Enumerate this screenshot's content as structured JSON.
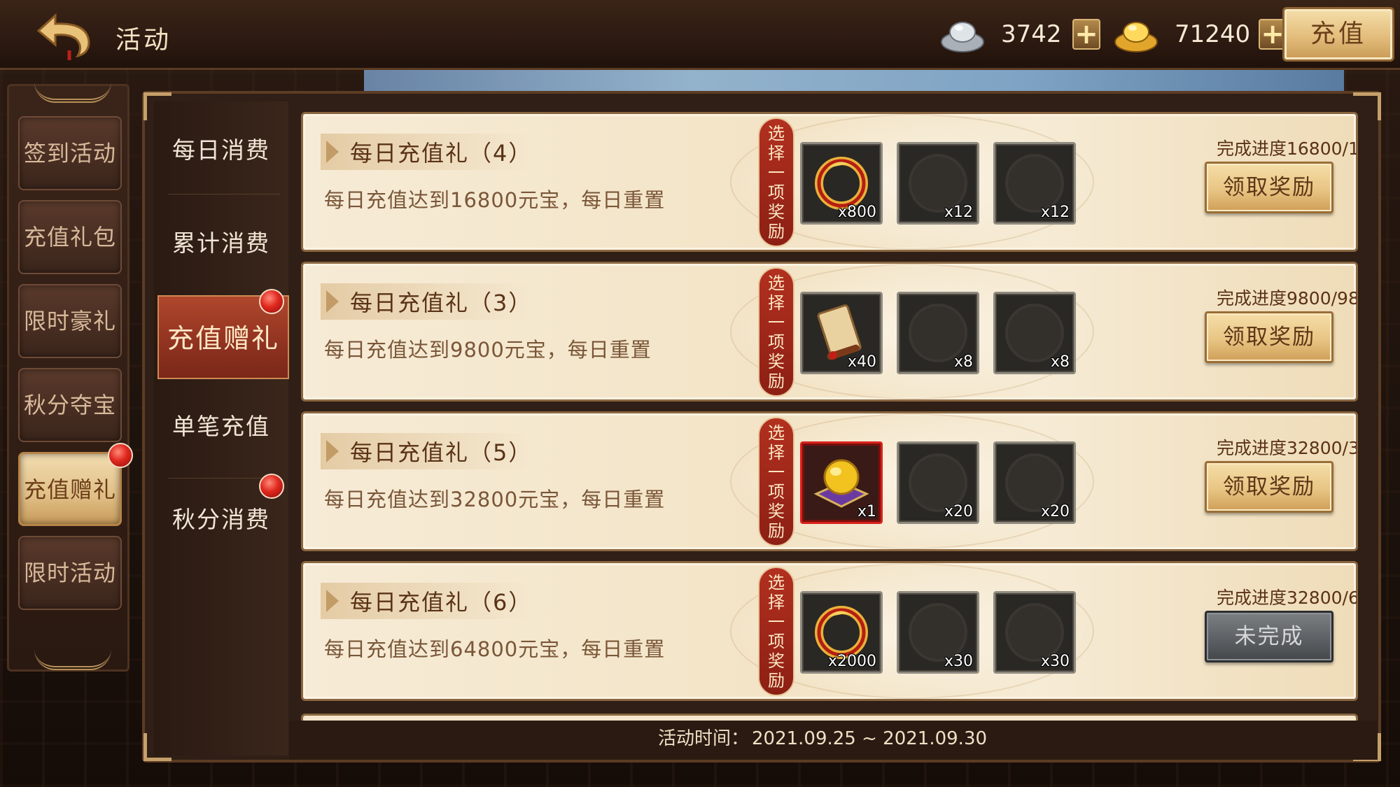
{
  "header": {
    "title": "活动",
    "silver_amount": "3742",
    "gold_amount": "71240",
    "plus_label": "+",
    "recharge_label": "充值"
  },
  "sidebar": {
    "items": [
      {
        "label": "签到活动"
      },
      {
        "label": "充值礼包"
      },
      {
        "label": "限时豪礼"
      },
      {
        "label": "秋分夺宝"
      },
      {
        "label": "充值赠礼"
      },
      {
        "label": "限时活动"
      }
    ],
    "active_index": 4
  },
  "subtabs": {
    "items": [
      {
        "label": "每日消费"
      },
      {
        "label": "累计消费"
      },
      {
        "label": "充值赠礼"
      },
      {
        "label": "单笔充值"
      },
      {
        "label": "秋分消费"
      }
    ],
    "active_index": 2
  },
  "select_tag_chars": [
    "选",
    "择",
    "一",
    "项",
    "奖",
    "励"
  ],
  "rows": [
    {
      "title": "每日充值礼（4）",
      "desc": "每日充值达到16800元宝，每日重置",
      "items": [
        {
          "icon": "dragon-ring-icon",
          "qty": "x800"
        },
        {
          "icon": "locked-emblem-icon",
          "qty": "x12"
        },
        {
          "icon": "locked-emblem-icon",
          "qty": "x12"
        }
      ],
      "progress": "完成进度16800/1",
      "button": "领取奖励",
      "button_state": "claimable"
    },
    {
      "title": "每日充值礼（3）",
      "desc": "每日充值达到9800元宝，每日重置",
      "items": [
        {
          "icon": "scroll-icon",
          "qty": "x40"
        },
        {
          "icon": "locked-emblem-icon",
          "qty": "x8"
        },
        {
          "icon": "locked-emblem-icon",
          "qty": "x8"
        }
      ],
      "progress": "完成进度9800/98",
      "button": "领取奖励",
      "button_state": "claimable"
    },
    {
      "title": "每日充值礼（5）",
      "desc": "每日充值达到32800元宝，每日重置",
      "items": [
        {
          "icon": "golden-orb-icon",
          "qty": "x1"
        },
        {
          "icon": "locked-emblem-icon",
          "qty": "x20"
        },
        {
          "icon": "locked-emblem-icon",
          "qty": "x20"
        }
      ],
      "progress": "完成进度32800/3",
      "button": "领取奖励",
      "button_state": "claimable"
    },
    {
      "title": "每日充值礼（6）",
      "desc": "每日充值达到64800元宝，每日重置",
      "items": [
        {
          "icon": "dragon-ring-icon",
          "qty": "x2000"
        },
        {
          "icon": "locked-emblem-icon",
          "qty": "x30"
        },
        {
          "icon": "locked-emblem-icon",
          "qty": "x30"
        }
      ],
      "progress": "完成进度32800/6",
      "button": "未完成",
      "button_state": "incomplete"
    }
  ],
  "footer": {
    "label": "活动时间：",
    "range": "2021.09.25 ~ 2021.09.30"
  },
  "colors": {
    "accent_red": "#8f3220",
    "gold": "#e8c584",
    "badge_red": "#e0281e"
  }
}
